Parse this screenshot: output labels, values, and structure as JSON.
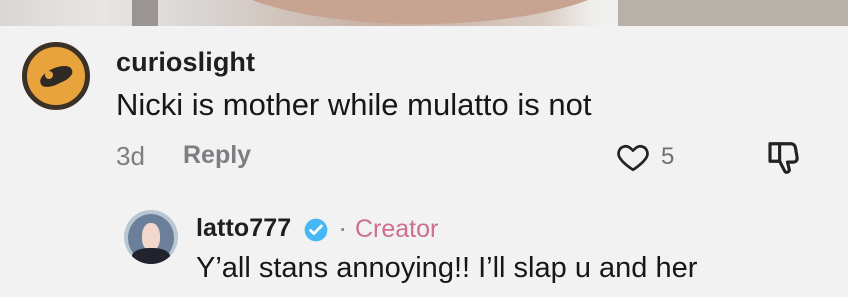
{
  "comment": {
    "username": "curioslight",
    "text": "Nicki is mother while mulatto is not",
    "time": "3d",
    "reply_label": "Reply",
    "like_count": "5",
    "icons": {
      "avatar": "avatar",
      "like": "heart-icon",
      "dislike": "dislike-icon"
    }
  },
  "reply": {
    "username": "latto777",
    "separator": "·",
    "badge": "Creator",
    "text": "Y’all stans annoying!! I’ll slap u and her",
    "verified": "verified-icon"
  },
  "colors": {
    "background": "#f2f2f3",
    "text_primary": "#171717",
    "text_secondary": "#7d7d82",
    "creator_pink": "#d06f8b",
    "verified_blue": "#45b7f4"
  }
}
